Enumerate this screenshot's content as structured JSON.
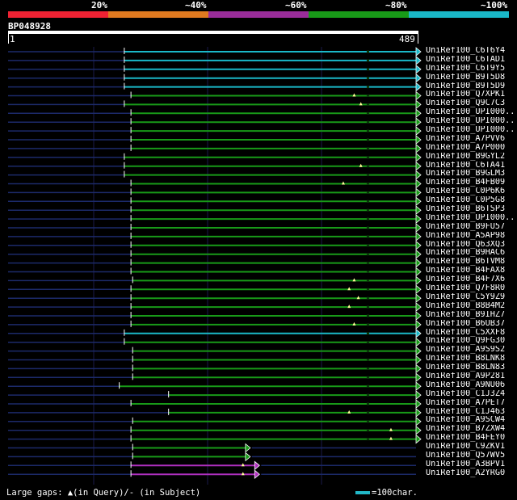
{
  "legend": {
    "labels": [
      "20%",
      "~40%",
      "~60%",
      "~80%",
      "~100%"
    ],
    "colors": [
      "#ee2233",
      "#e07a20",
      "#9a2d9a",
      "#189a18",
      "#1ab8c8"
    ]
  },
  "query": {
    "id": "BP048928",
    "start": "1",
    "end": "489"
  },
  "hits": [
    {
      "name": "UniRef100_C6T6Y4",
      "q_start": 1,
      "s_start": 140,
      "s_end": 489,
      "color": "cyan",
      "ins": []
    },
    {
      "name": "UniRef100_C6TAD1",
      "q_start": 1,
      "s_start": 140,
      "s_end": 489,
      "color": "cyan",
      "ins": []
    },
    {
      "name": "UniRef100_C6T9Y5",
      "q_start": 1,
      "s_start": 140,
      "s_end": 489,
      "color": "cyan",
      "ins": []
    },
    {
      "name": "UniRef100_B9T5D8",
      "q_start": 1,
      "s_start": 140,
      "s_end": 489,
      "color": "cyan",
      "ins": []
    },
    {
      "name": "UniRef100_B9T5D9",
      "q_start": 1,
      "s_start": 140,
      "s_end": 489,
      "color": "cyan",
      "ins": []
    },
    {
      "name": "UniRef100_Q7XPK1",
      "q_start": 1,
      "s_start": 148,
      "s_end": 489,
      "color": "green",
      "ins": [
        415
      ]
    },
    {
      "name": "UniRef100_Q9C7C3",
      "q_start": 1,
      "s_start": 140,
      "s_end": 489,
      "color": "green",
      "ins": [
        423
      ]
    },
    {
      "name": "UniRef100_UPI000..",
      "q_start": 1,
      "s_start": 148,
      "s_end": 489,
      "color": "green",
      "ins": []
    },
    {
      "name": "UniRef100_UPI000..",
      "q_start": 1,
      "s_start": 148,
      "s_end": 489,
      "color": "green",
      "ins": []
    },
    {
      "name": "UniRef100_UPI000..",
      "q_start": 1,
      "s_start": 148,
      "s_end": 489,
      "color": "green",
      "ins": []
    },
    {
      "name": "UniRef100_A7PVV6",
      "q_start": 1,
      "s_start": 148,
      "s_end": 489,
      "color": "green",
      "ins": []
    },
    {
      "name": "UniRef100_A7P000",
      "q_start": 1,
      "s_start": 148,
      "s_end": 489,
      "color": "green",
      "ins": []
    },
    {
      "name": "UniRef100_B9GYL2",
      "q_start": 1,
      "s_start": 140,
      "s_end": 489,
      "color": "green",
      "ins": []
    },
    {
      "name": "UniRef100_C6TA41",
      "q_start": 1,
      "s_start": 140,
      "s_end": 489,
      "color": "green",
      "ins": [
        423
      ]
    },
    {
      "name": "UniRef100_B9GLM3",
      "q_start": 1,
      "s_start": 140,
      "s_end": 489,
      "color": "green",
      "ins": []
    },
    {
      "name": "UniRef100_B4FB09",
      "q_start": 1,
      "s_start": 148,
      "s_end": 489,
      "color": "green",
      "ins": [
        402
      ]
    },
    {
      "name": "UniRef100_C0P6K6",
      "q_start": 1,
      "s_start": 148,
      "s_end": 489,
      "color": "green",
      "ins": []
    },
    {
      "name": "UniRef100_C0P5G8",
      "q_start": 1,
      "s_start": 148,
      "s_end": 489,
      "color": "green",
      "ins": []
    },
    {
      "name": "UniRef100_B6TSP3",
      "q_start": 1,
      "s_start": 148,
      "s_end": 489,
      "color": "green",
      "ins": []
    },
    {
      "name": "UniRef100_UPI000..",
      "q_start": 1,
      "s_start": 148,
      "s_end": 489,
      "color": "green",
      "ins": []
    },
    {
      "name": "UniRef100_B9FU57",
      "q_start": 1,
      "s_start": 148,
      "s_end": 489,
      "color": "green",
      "ins": []
    },
    {
      "name": "UniRef100_A5AP98",
      "q_start": 1,
      "s_start": 148,
      "s_end": 489,
      "color": "green",
      "ins": []
    },
    {
      "name": "UniRef100_Q63XQ3",
      "q_start": 1,
      "s_start": 148,
      "s_end": 489,
      "color": "green",
      "ins": []
    },
    {
      "name": "UniRef100_B9HAC6",
      "q_start": 1,
      "s_start": 148,
      "s_end": 489,
      "color": "green",
      "ins": []
    },
    {
      "name": "UniRef100_B6TVM8",
      "q_start": 1,
      "s_start": 148,
      "s_end": 489,
      "color": "green",
      "ins": []
    },
    {
      "name": "UniRef100_B4FAX8",
      "q_start": 1,
      "s_start": 148,
      "s_end": 489,
      "color": "green",
      "ins": []
    },
    {
      "name": "UniRef100_B4F7X6",
      "q_start": 1,
      "s_start": 150,
      "s_end": 489,
      "color": "green",
      "ins": [
        415
      ]
    },
    {
      "name": "UniRef100_Q7F8R0",
      "q_start": 1,
      "s_start": 148,
      "s_end": 489,
      "color": "green",
      "ins": [
        409
      ]
    },
    {
      "name": "UniRef100_C5Y9Z9",
      "q_start": 1,
      "s_start": 148,
      "s_end": 489,
      "color": "green",
      "ins": [
        420
      ]
    },
    {
      "name": "UniRef100_B8B4M2",
      "q_start": 1,
      "s_start": 148,
      "s_end": 489,
      "color": "green",
      "ins": [
        409
      ]
    },
    {
      "name": "UniRef100_B9IHZ7",
      "q_start": 1,
      "s_start": 148,
      "s_end": 489,
      "color": "green",
      "ins": []
    },
    {
      "name": "UniRef100_B6UB37",
      "q_start": 1,
      "s_start": 148,
      "s_end": 489,
      "color": "green",
      "ins": [
        415
      ]
    },
    {
      "name": "UniRef100_C5XXF8",
      "q_start": 1,
      "s_start": 140,
      "s_end": 489,
      "color": "cyan",
      "ins": []
    },
    {
      "name": "UniRef100_Q9FG30",
      "q_start": 1,
      "s_start": 140,
      "s_end": 489,
      "color": "green",
      "ins": []
    },
    {
      "name": "UniRef100_A9S9S2",
      "q_start": 1,
      "s_start": 150,
      "s_end": 489,
      "color": "green",
      "ins": []
    },
    {
      "name": "UniRef100_B8LNK8",
      "q_start": 1,
      "s_start": 150,
      "s_end": 489,
      "color": "green",
      "ins": []
    },
    {
      "name": "UniRef100_B8LN83",
      "q_start": 1,
      "s_start": 150,
      "s_end": 489,
      "color": "green",
      "ins": []
    },
    {
      "name": "UniRef100_A9P281",
      "q_start": 1,
      "s_start": 150,
      "s_end": 489,
      "color": "green",
      "ins": []
    },
    {
      "name": "UniRef100_A9NU06",
      "q_start": 1,
      "s_start": 134,
      "s_end": 489,
      "color": "green",
      "ins": []
    },
    {
      "name": "UniRef100_C1J3Z4",
      "q_start": 1,
      "s_start": 193,
      "s_end": 489,
      "color": "green",
      "ins": []
    },
    {
      "name": "UniRef100_A7PET7",
      "q_start": 1,
      "s_start": 148,
      "s_end": 489,
      "color": "green",
      "ins": []
    },
    {
      "name": "UniRef100_C1J463",
      "q_start": 1,
      "s_start": 193,
      "s_end": 489,
      "color": "green",
      "ins": [
        409
      ]
    },
    {
      "name": "UniRef100_A9SCW4",
      "q_start": 1,
      "s_start": 150,
      "s_end": 489,
      "color": "green",
      "ins": []
    },
    {
      "name": "UniRef100_B7ZXW4",
      "q_start": 1,
      "s_start": 148,
      "s_end": 489,
      "color": "green",
      "ins": [
        459
      ]
    },
    {
      "name": "UniRef100_B4FEY0",
      "q_start": 1,
      "s_start": 148,
      "s_end": 489,
      "color": "green",
      "ins": [
        459
      ]
    },
    {
      "name": "UniRef100_C9ZKV1",
      "q_start": 1,
      "s_start": 150,
      "s_end": 285,
      "color": "green",
      "ins": []
    },
    {
      "name": "UniRef100_Q57WV5",
      "q_start": 1,
      "s_start": 150,
      "s_end": 285,
      "color": "green",
      "ins": []
    },
    {
      "name": "UniRef100_A3BPV1",
      "q_start": 1,
      "s_start": 148,
      "s_end": 296,
      "color": "purple",
      "ins": [
        282
      ]
    },
    {
      "name": "UniRef100_A2YRG0",
      "q_start": 1,
      "s_start": 148,
      "s_end": 296,
      "color": "purple",
      "ins": [
        282
      ]
    }
  ],
  "footer": {
    "gaps_label": "Large gaps: ▲(in Query)/- (in Subject)",
    "scale_label": "=100char."
  }
}
